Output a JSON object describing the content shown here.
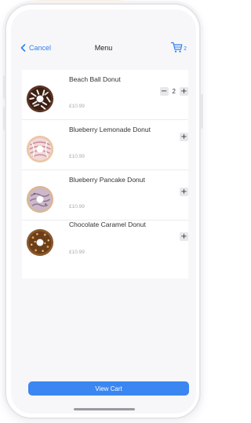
{
  "nav": {
    "cancel_label": "Cancel",
    "title": "Menu",
    "cart_icon": "shopping-cart-icon",
    "cart_count": "2"
  },
  "items": [
    {
      "name": "Beach Ball Donut",
      "price": "£10.99",
      "quantity": "2",
      "has_stepper": true,
      "donut_style": "chocolate-sprinkle"
    },
    {
      "name": "Blueberry Lemonade Donut",
      "price": "£10.99",
      "has_stepper": false,
      "donut_style": "pink-drizzle"
    },
    {
      "name": "Blueberry Pancake Donut",
      "price": "£10.99",
      "has_stepper": false,
      "donut_style": "lavender-swirl"
    },
    {
      "name": "Chocolate Caramel Donut",
      "price": "£10.99",
      "has_stepper": false,
      "donut_style": "caramel-nut"
    }
  ],
  "controls": {
    "minus_symbol": "−",
    "plus_symbol": "+"
  },
  "footer": {
    "view_cart_label": "View Cart"
  },
  "colors": {
    "accent": "#3b86f0",
    "link": "#2f80ed"
  }
}
